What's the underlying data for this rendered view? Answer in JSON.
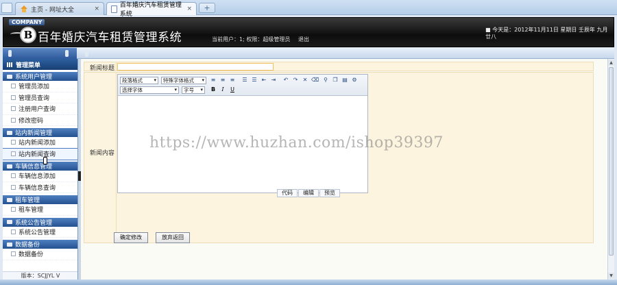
{
  "browser": {
    "tabs": [
      {
        "label": "主页 - 网址大全",
        "close": "×"
      },
      {
        "label": "百年婚庆汽车租赁管理系统",
        "close": "×"
      }
    ],
    "new_tab": "+"
  },
  "header": {
    "company": "COMPANY",
    "logo_letter": "B",
    "title": "百年婚庆汽车租赁管理系统",
    "user_info": "当前用户：1; 权限：超级管理员",
    "logout": "退出",
    "date": "■ 今天是：2012年11月11日 星期日 壬辰年 九月廿八"
  },
  "sidebar": {
    "menu_title": "管理菜单",
    "groups": [
      {
        "title": "系统用户管理",
        "items": [
          "管理员添加",
          "管理员查询",
          "注册用户查询",
          "修改密码"
        ]
      },
      {
        "title": "站内新闻管理",
        "items": [
          "站内新闻添加",
          "站内新闻查询"
        ]
      },
      {
        "title": "车辆信息管理",
        "items": [
          "车辆信息添加",
          "车辆信息查询"
        ]
      },
      {
        "title": "租车管理",
        "items": [
          "租车管理"
        ]
      },
      {
        "title": "系统公告管理",
        "items": [
          "系统公告管理"
        ]
      },
      {
        "title": "数据备份",
        "items": [
          "数据备份"
        ]
      }
    ],
    "version": "版本：SCJJYL V"
  },
  "form": {
    "title_label": "新闻标题",
    "title_value": "",
    "content_label": "新闻内容",
    "editor": {
      "format_select": "段落格式",
      "style_select": "特殊字体格式",
      "font_select": "选择字体",
      "size_select": "字号",
      "bold": "B",
      "italic": "I",
      "underline": "U",
      "modes": [
        "代码",
        "编辑",
        "预览"
      ]
    },
    "submit_button": "确定修改",
    "cancel_button": "放弃返回"
  },
  "watermark": "https://www.huzhan.com/ishop39397"
}
